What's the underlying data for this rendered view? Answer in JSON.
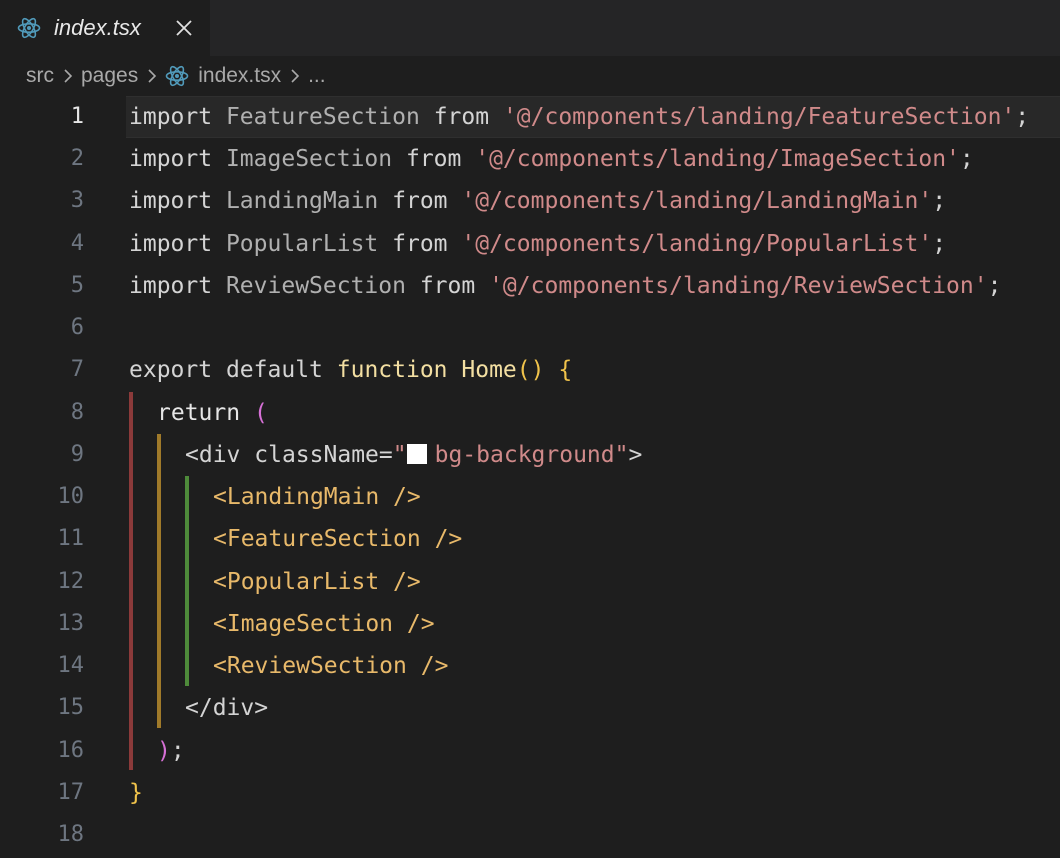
{
  "tab": {
    "title": "index.tsx",
    "icon": "react-icon",
    "close_glyph": "✕"
  },
  "breadcrumbs": {
    "items": [
      "src",
      "pages",
      "index.tsx",
      "..."
    ]
  },
  "colors": {
    "react_icon": "#519aba",
    "string": "#d08a8a",
    "function_name": "#f3dfa2",
    "brace": "#f0c34b",
    "paren": "#d670d6",
    "jsx_tag": "#e8b96a",
    "guide_red": "#8b3a3a",
    "guide_gold": "#a07a2a",
    "guide_green": "#4e8a3a"
  },
  "editor": {
    "active_line": 1,
    "line_numbers": [
      "1",
      "2",
      "3",
      "4",
      "5",
      "6",
      "7",
      "8",
      "9",
      "10",
      "11",
      "12",
      "13",
      "14",
      "15",
      "16",
      "17",
      "18"
    ],
    "lines": {
      "l1": {
        "kw": "import",
        "name": "FeatureSection",
        "from": "from",
        "path": "'@/components/landing/FeatureSection'",
        "end": ";"
      },
      "l2": {
        "kw": "import",
        "name": "ImageSection",
        "from": "from",
        "path": "'@/components/landing/ImageSection'",
        "end": ";"
      },
      "l3": {
        "kw": "import",
        "name": "LandingMain",
        "from": "from",
        "path": "'@/components/landing/LandingMain'",
        "end": ";"
      },
      "l4": {
        "kw": "import",
        "name": "PopularList",
        "from": "from",
        "path": "'@/components/landing/PopularList'",
        "end": ";"
      },
      "l5": {
        "kw": "import",
        "name": "ReviewSection",
        "from": "from",
        "path": "'@/components/landing/ReviewSection'",
        "end": ";"
      },
      "l7": {
        "export": "export",
        "default": "default",
        "function": "function",
        "fname": "Home",
        "parens": "()",
        "brace": "{"
      },
      "l8": {
        "ret": "return",
        "paren": "("
      },
      "l9": {
        "lt": "<",
        "tag": "div",
        "attr": "className",
        "eq": "=",
        "q1": "\"",
        "value": "bg-background",
        "q2": "\"",
        "gt": ">"
      },
      "l10": {
        "open": "<",
        "tag": "LandingMain",
        "close": " />"
      },
      "l11": {
        "open": "<",
        "tag": "FeatureSection",
        "close": " />"
      },
      "l12": {
        "open": "<",
        "tag": "PopularList",
        "close": " />"
      },
      "l13": {
        "open": "<",
        "tag": "ImageSection",
        "close": " />"
      },
      "l14": {
        "open": "<",
        "tag": "ReviewSection",
        "close": " />"
      },
      "l15": {
        "open": "</",
        "tag": "div",
        "close": ">"
      },
      "l16": {
        "paren": ")",
        "end": ";"
      },
      "l17": {
        "brace": "}"
      }
    }
  }
}
